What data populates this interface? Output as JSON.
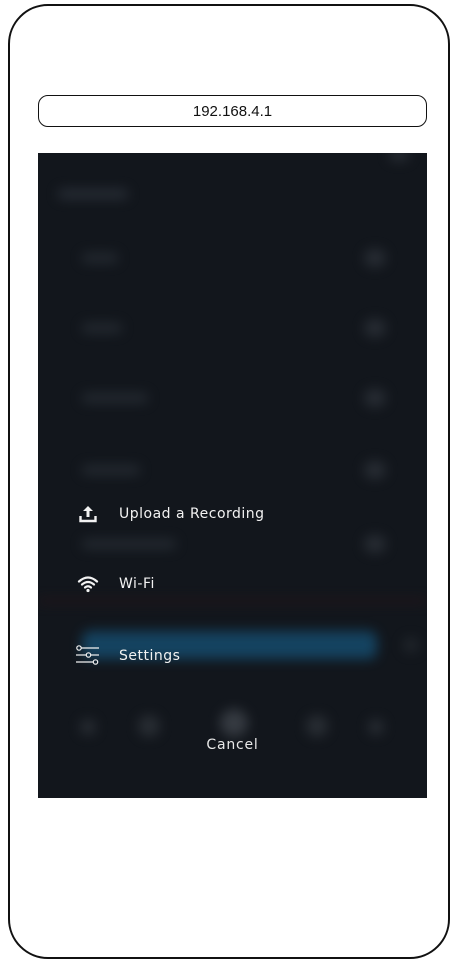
{
  "browser": {
    "url": "192.168.4.1"
  },
  "menu": {
    "items": [
      {
        "label": "Upload a Recording",
        "icon": "upload-icon"
      },
      {
        "label": "Wi-Fi",
        "icon": "wifi-icon"
      },
      {
        "label": "Settings",
        "icon": "sliders-icon"
      }
    ],
    "cancel_label": "Cancel"
  },
  "colors": {
    "screen_background": "#12161c",
    "menu_text": "#f2f2f2",
    "highlight_glow": "#154868"
  }
}
